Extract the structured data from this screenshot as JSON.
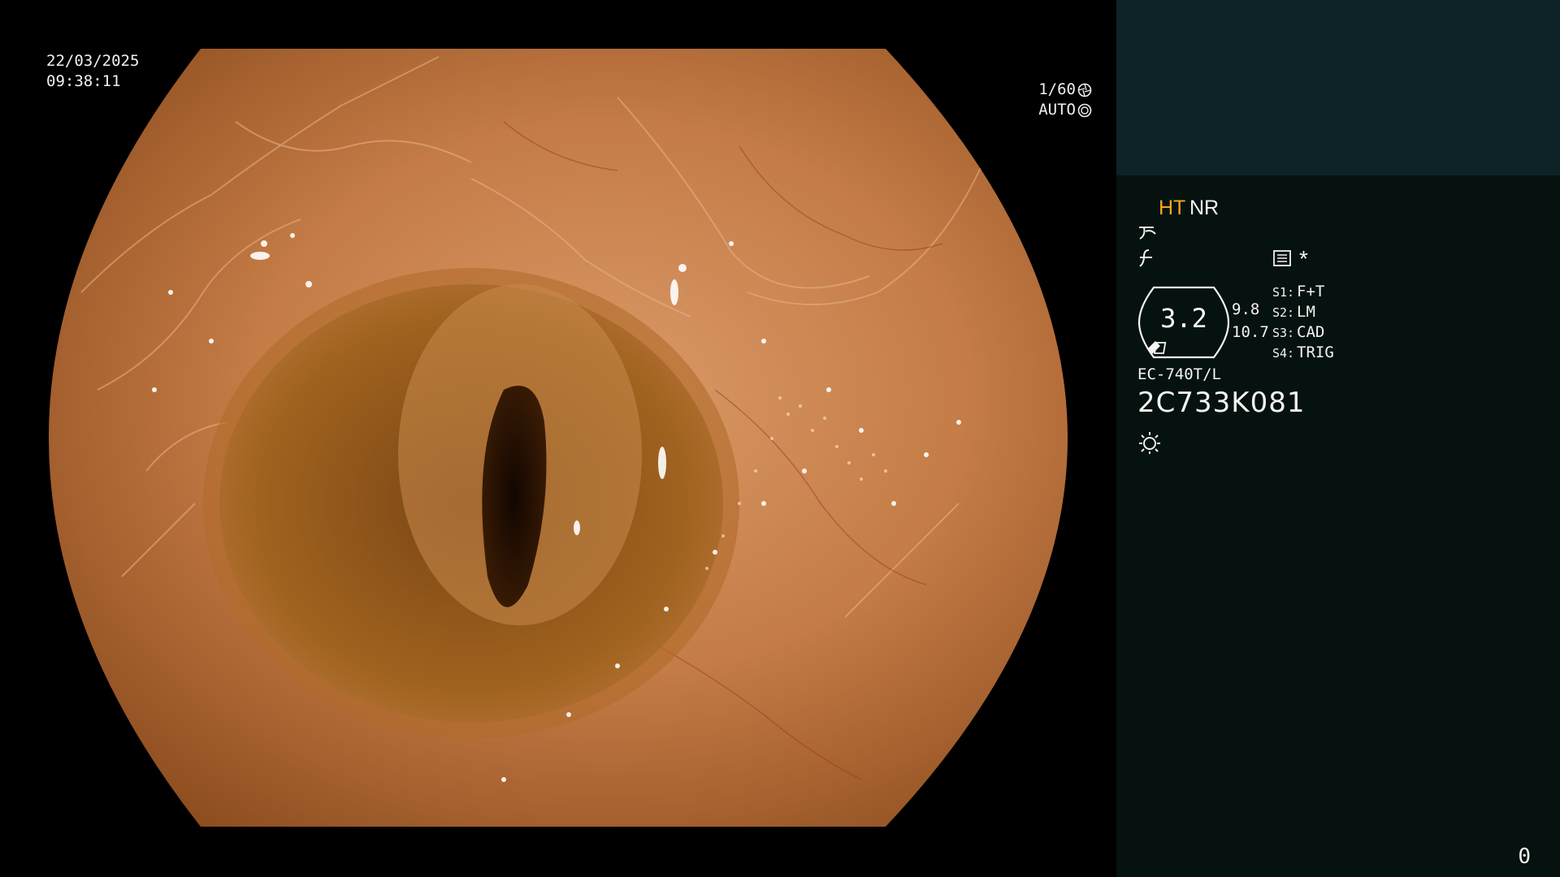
{
  "screen": {
    "date": "22/03/2025",
    "time": "09:38:11"
  },
  "exposure": {
    "shutter": "1/60",
    "shutter_icon": "aperture-icon",
    "mode": "AUTO",
    "mode_icon": "iris-icon"
  },
  "panel": {
    "mode_ht": "HT",
    "mode_nr": "NR",
    "ht_color": "#f5a623",
    "icons": [
      "enhance-curve-icon",
      "structure-icon",
      "menu-list-icon",
      "asterisk-icon",
      "light-icon"
    ],
    "asterisk": "*",
    "lens": {
      "value": "3.2",
      "top_value": "9.8",
      "bottom_value": "10.7"
    },
    "slots": [
      {
        "key": "S1:",
        "value": "F+T"
      },
      {
        "key": "S2:",
        "value": "LM"
      },
      {
        "key": "S3:",
        "value": "CAD"
      },
      {
        "key": "S4:",
        "value": "TRIG"
      }
    ],
    "scope_model": "EC-740T/L",
    "serial": "2C733K081",
    "counter": "0"
  },
  "colors": {
    "panel_bg": "#061210",
    "panel_top_bg": "#0e2326",
    "mucosa": "#c27a45",
    "lumen": "#2a1404"
  }
}
